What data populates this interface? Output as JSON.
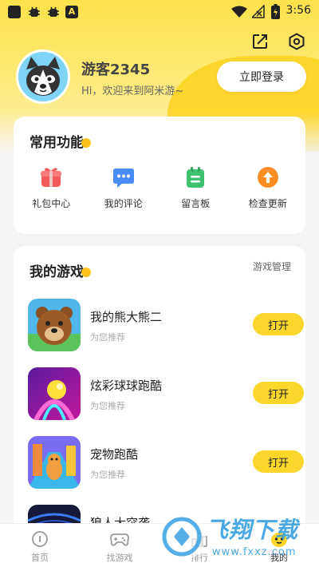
{
  "status_bar": {
    "icon_text": "A",
    "time": "3:56"
  },
  "profile": {
    "nickname": "游客2345",
    "welcome": "Hi，欢迎来到阿米游~",
    "login_label": "立即登录"
  },
  "functions": {
    "title": "常用功能",
    "items": [
      {
        "label": "礼包中心",
        "icon": "gift-icon",
        "color": "#f35b5b"
      },
      {
        "label": "我的评论",
        "icon": "comment-icon",
        "color": "#4a8cf7"
      },
      {
        "label": "留言板",
        "icon": "message-board-icon",
        "color": "#3dc26e"
      },
      {
        "label": "检查更新",
        "icon": "update-icon",
        "color": "#fb8d22"
      }
    ]
  },
  "games": {
    "title": "我的游戏",
    "manage_label": "游戏管理",
    "list": [
      {
        "name": "我的熊大熊二",
        "sub": "为您推荐",
        "action": "打开"
      },
      {
        "name": "炫彩球球跑酷",
        "sub": "为您推荐",
        "action": "打开"
      },
      {
        "name": "宠物跑酷",
        "sub": "为您推荐",
        "action": "打开"
      },
      {
        "name": "狼人大突袭",
        "sub": "",
        "action": ""
      }
    ]
  },
  "tabbar": {
    "items": [
      {
        "label": "首页",
        "icon": "home-icon",
        "active": false
      },
      {
        "label": "找游戏",
        "icon": "gamepad-icon",
        "active": false
      },
      {
        "label": "排行",
        "icon": "ranking-icon",
        "active": false
      },
      {
        "label": "我的",
        "icon": "profile-icon",
        "active": true
      }
    ]
  },
  "watermark": {
    "text": "飞翔下载",
    "url_text": "www.fxxz.com"
  },
  "colors": {
    "accent_yellow": "#fdd62b",
    "header_yellow": "#fde24b"
  }
}
